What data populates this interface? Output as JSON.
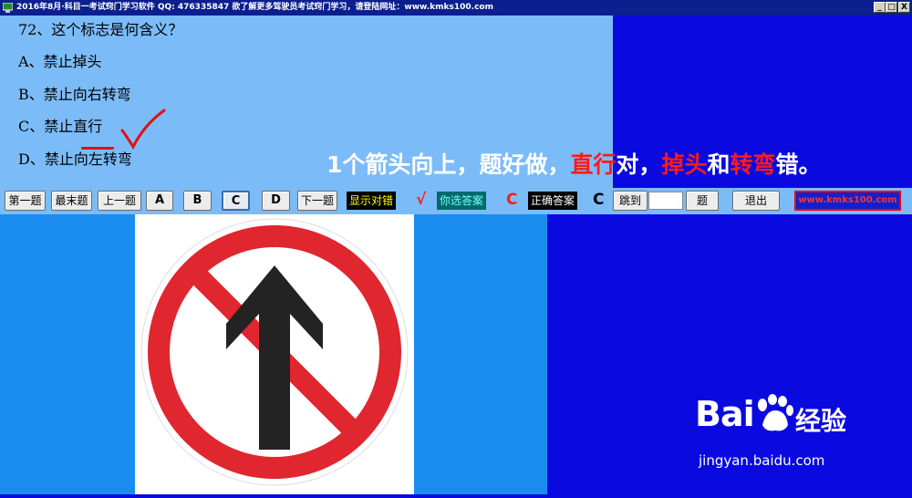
{
  "window": {
    "title": "2016年8月·科目一考试窍门学习软件  QQ: 476335847 欲了解更多驾驶员考试窍门学习，请登陆网址：www.kmks100.com",
    "min_label": "_",
    "max_label": "□",
    "close_label": "X"
  },
  "question": {
    "text": "72、这个标志是何含义？",
    "option_a": "A、禁止掉头",
    "option_b": "B、禁止向右转弯",
    "option_c_prefix": "C、禁止",
    "option_c_key": "直行",
    "option_d": "D、禁止向左转弯"
  },
  "banner": {
    "p1": "1个箭头向上，题好做，",
    "r1": "直行",
    "p2": "对，",
    "r2": "掉头",
    "p3": "和",
    "r3": "转弯",
    "p4": "错。"
  },
  "toolbar": {
    "first": "第一题",
    "last": "最末题",
    "prev": "上一题",
    "a": "A",
    "b": "B",
    "c": "C",
    "d": "D",
    "next": "下一题",
    "show_result": "显示对错",
    "result_mark": "√",
    "your_answer_label": "你选答案",
    "your_answer": "C",
    "correct_answer_label": "正确答案",
    "correct_answer": "C",
    "jump": "跳到",
    "jump_value": "",
    "jump_suffix": "题",
    "exit": "退出",
    "site": "www.kmks100.com"
  },
  "watermark": {
    "brand": "Bai",
    "brand2": "经验",
    "url": "jingyan.baidu.com"
  },
  "colors": {
    "question_bg": "#7bbcf8",
    "blue_panel": "#0a0ae0",
    "sign_red": "#e0262e"
  }
}
